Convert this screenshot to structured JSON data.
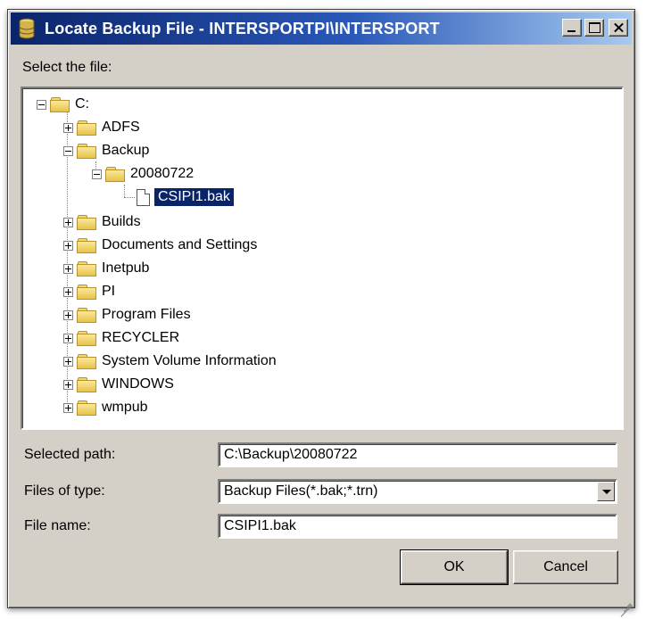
{
  "window": {
    "title": "Locate Backup File - INTERSPORTPI\\INTERSPORT",
    "icon": "backup-database-icon"
  },
  "tree_label": "Select the file:",
  "tree": {
    "root": "C:",
    "adfs": "ADFS",
    "backup": "Backup",
    "backup_sub": "20080722",
    "file": "CSIPI1.bak",
    "builds": "Builds",
    "docs": "Documents and Settings",
    "inetpub": "Inetpub",
    "pi": "PI",
    "program_files": "Program Files",
    "recycler": "RECYCLER",
    "svi": "System Volume Information",
    "windows": "WINDOWS",
    "wmpub": "wmpub"
  },
  "form": {
    "selected_path_label": "Selected path:",
    "selected_path_value": "C:\\Backup\\20080722",
    "files_of_type_label": "Files of type:",
    "files_of_type_value": "Backup Files(*.bak;*.trn)",
    "file_name_label": "File name:",
    "file_name_value": "CSIPI1.bak"
  },
  "buttons": {
    "ok": "OK",
    "cancel": "Cancel"
  },
  "colors": {
    "titlebar_start": "#0a246a",
    "titlebar_end": "#a6caf0",
    "selection": "#0a246a",
    "dialog_bg": "#d4d0c8"
  }
}
